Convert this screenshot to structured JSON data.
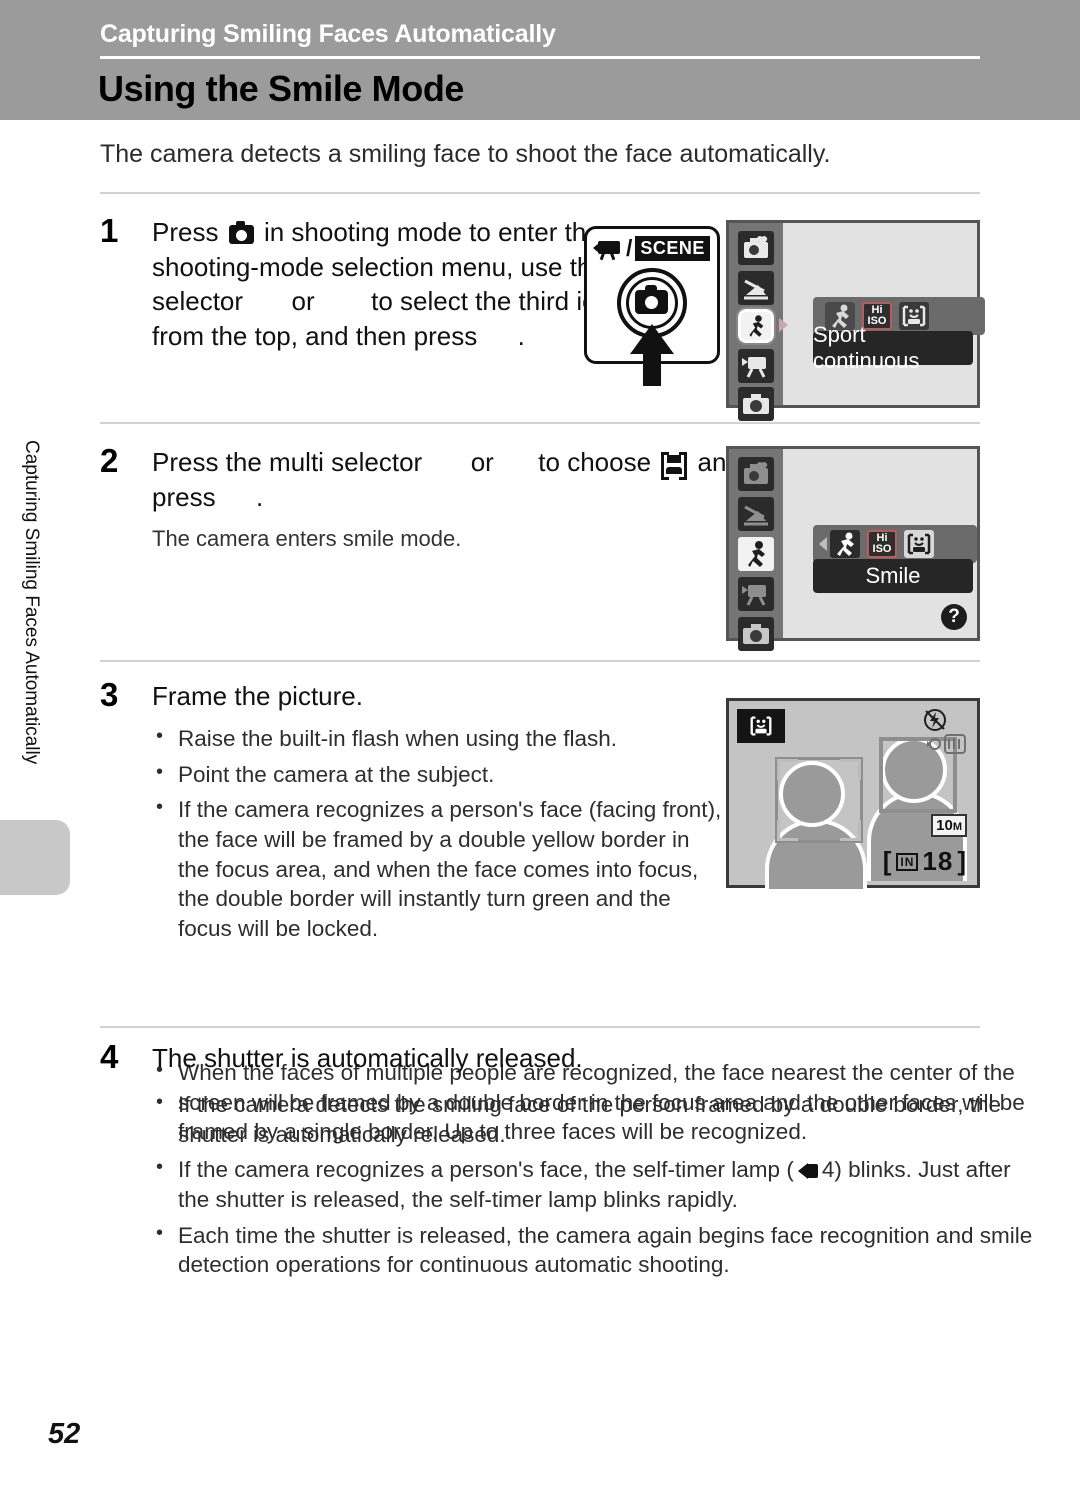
{
  "header": {
    "chapter": "Capturing Smiling Faces Automatically",
    "title": "Using the Smile Mode"
  },
  "side_tab": {
    "label": "Capturing Smiling Faces Automatically"
  },
  "intro": "The camera detects a smiling face to shoot the face automatically.",
  "steps": [
    {
      "number": "1",
      "text_a": "Press",
      "text_b": "in shooting mode to enter the shooting-mode selection menu, use the multi selector",
      "text_c": "or",
      "text_d": "to select the third icon from the top, and then press",
      "text_e": "."
    },
    {
      "number": "2",
      "text_a": "Press the multi selector",
      "text_b": "or",
      "text_c": "to choose",
      "text_d": "and press",
      "text_e": ".",
      "note": "The camera enters smile mode."
    },
    {
      "number": "3",
      "title": "Frame the picture.",
      "bullets": [
        "Raise the built-in flash when using the flash.",
        "Point the camera at the subject.",
        "If the camera recognizes a person's face (facing front), the face will be framed by a double yellow border in the focus area, and when the face comes into focus, the double border will instantly turn green and the focus will be locked.",
        "When the faces of multiple people are recognized, the face nearest the center of the screen will be framed by a double border in the focus area and the other faces will be framed by a single border. Up to three faces will be recognized."
      ]
    },
    {
      "number": "4",
      "title": "The shutter is automatically released.",
      "bullets": [
        "If the camera detects the smiling face of the person framed by a double border, the shutter is automatically released.",
        "If the camera recognizes a person's face, the self-timer lamp (",
        "Each time the shutter is released, the camera again begins face recognition and smile detection operations for continuous automatic shooting."
      ],
      "selftimer_ref": "4) blinks. Just after the shutter is released, the self-timer lamp blinks rapidly."
    }
  ],
  "button_illustration": {
    "movie_icon": "movie-camera-icon",
    "separator": "/",
    "scene_label": "SCENE",
    "mode_button": "shooting-mode-button",
    "arrow": "press-arrow-up"
  },
  "screen_step1": {
    "mode_column": [
      "portrait-heart-icon",
      "night-scene-icon",
      "sport-runner-icon",
      "movie-icon",
      "auto-camera-icon"
    ],
    "selected_column_index": 2,
    "submenu_icons": [
      "sport-runner-icon",
      "high-iso-icon",
      "smile-face-icon"
    ],
    "submenu_selected_index": 0,
    "label": "Sport continuous",
    "iso_text_top": "Hi",
    "iso_text_bottom": "ISO"
  },
  "screen_step2": {
    "mode_column": [
      "portrait-heart-icon",
      "night-scene-icon",
      "sport-runner-icon",
      "movie-icon",
      "auto-camera-icon"
    ],
    "selected_column_index": 2,
    "submenu_icons": [
      "sport-runner-icon",
      "high-iso-icon",
      "smile-face-icon"
    ],
    "submenu_selected_index": 2,
    "label": "Smile",
    "iso_text_top": "Hi",
    "iso_text_bottom": "ISO",
    "help_badge": "?"
  },
  "screen_step3": {
    "mode_badge": "smile-face-icon",
    "flash_icon": "flash-off-icon",
    "shake_icon": "camera-shake-warning-icon",
    "image_size_badge": "10M",
    "image_size_unit": "M",
    "image_size_number": "10",
    "shots_remaining": "18",
    "memory_label": "IN",
    "counter_text": "[ 18 ]",
    "subject_left": "face-with-double-border",
    "subject_right": "face-with-single-border"
  },
  "footer": {
    "page_number": "52"
  },
  "colors": {
    "header_band": "#9b9b9b",
    "lcd_background": "#e2e2e2",
    "lcd_column": "#757575",
    "label_bar": "#262626",
    "side_tab_block": "#c8c8c8"
  }
}
